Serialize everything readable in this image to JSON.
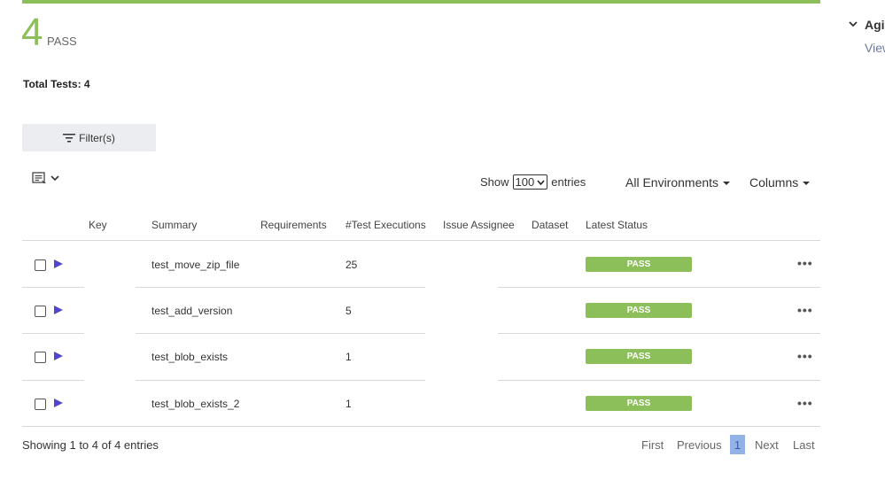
{
  "summary": {
    "count": "4",
    "label": "PASS",
    "total_tests": "Total Tests: 4",
    "accent_color": "#8cbf5a"
  },
  "toolbar": {
    "filter_label": "Filter(s)",
    "show_label": "Show",
    "entries_value": "100",
    "entries_label": "entries",
    "environments_label": "All Environments",
    "columns_label": "Columns"
  },
  "table": {
    "headers": {
      "key": "Key",
      "summary": "Summary",
      "requirements": "Requirements",
      "test_executions": "#Test Executions",
      "issue_assignee": "Issue Assignee",
      "dataset": "Dataset",
      "latest_status": "Latest Status"
    },
    "rows": [
      {
        "summary": "test_move_zip_file",
        "executions": "25",
        "status": "PASS"
      },
      {
        "summary": "test_add_version",
        "executions": "5",
        "status": "PASS"
      },
      {
        "summary": "test_blob_exists",
        "executions": "1",
        "status": "PASS"
      },
      {
        "summary": "test_blob_exists_2",
        "executions": "1",
        "status": "PASS"
      }
    ]
  },
  "pagination": {
    "info": "Showing 1 to 4 of 4 entries",
    "first": "First",
    "previous": "Previous",
    "current": "1",
    "next": "Next",
    "last": "Last"
  },
  "side_panel": {
    "title": "Agi",
    "link": "View"
  },
  "icons": {
    "filter": "filter-lines-icon",
    "view": "table-view-icon",
    "chevron": "chevron-down-icon",
    "run": "play-arrow-icon",
    "more": "ellipsis-icon"
  }
}
